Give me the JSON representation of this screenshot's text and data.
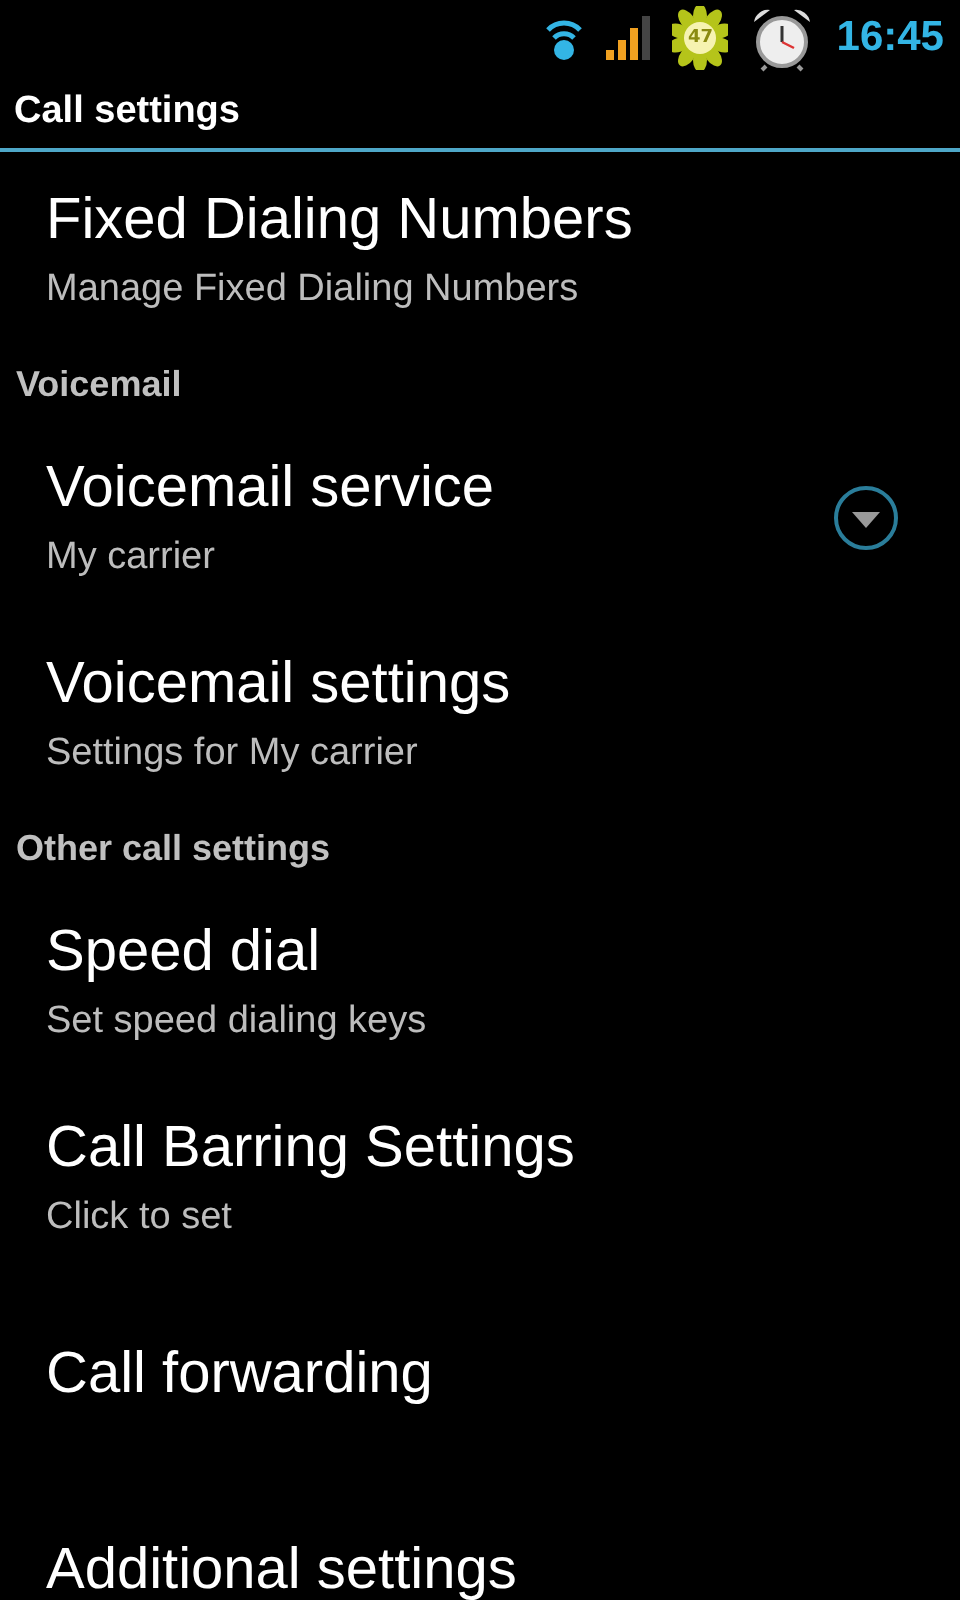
{
  "status_bar": {
    "flower_badge": "47",
    "time": "16:45"
  },
  "title": "Call settings",
  "items": [
    {
      "kind": "pref",
      "title": "Fixed Dialing Numbers",
      "summary": "Manage Fixed Dialing Numbers",
      "dropdown": false
    },
    {
      "kind": "category",
      "title": "Voicemail"
    },
    {
      "kind": "pref",
      "title": "Voicemail service",
      "summary": "My carrier",
      "dropdown": true
    },
    {
      "kind": "pref",
      "title": "Voicemail settings",
      "summary": "Settings for My carrier",
      "dropdown": false
    },
    {
      "kind": "category",
      "title": "Other call settings"
    },
    {
      "kind": "pref",
      "title": "Speed dial",
      "summary": "Set speed dialing keys",
      "dropdown": false
    },
    {
      "kind": "pref",
      "title": "Call Barring Settings",
      "summary": "Click to set",
      "dropdown": false
    },
    {
      "kind": "pref",
      "title": "Call forwarding",
      "dropdown": false
    },
    {
      "kind": "pref",
      "title": "Additional settings",
      "dropdown": false
    }
  ]
}
